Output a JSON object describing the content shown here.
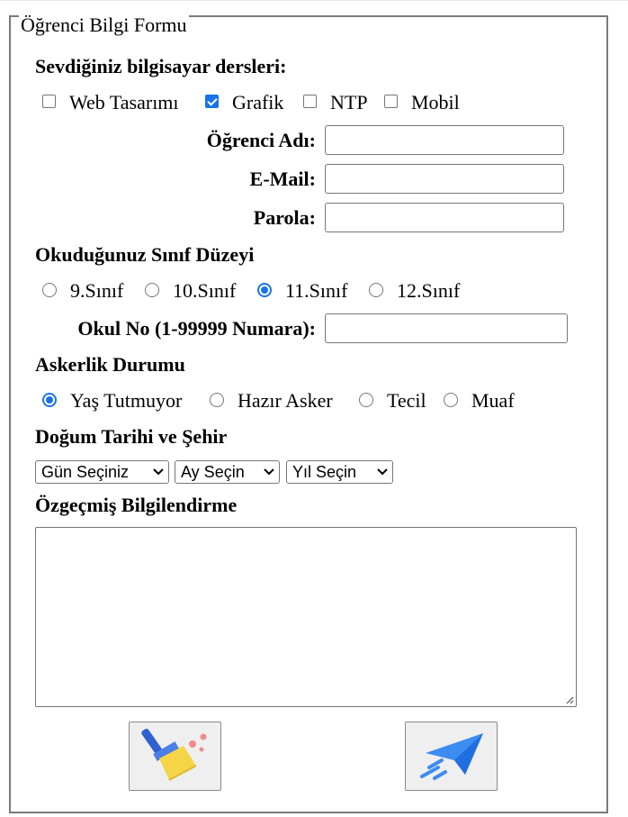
{
  "form": {
    "legend": "Öğrenci Bilgi Formu",
    "courses": {
      "heading": "Sevdiğiniz bilgisayar dersleri:",
      "options": [
        {
          "label": "Web Tasarımı",
          "checked": false
        },
        {
          "label": "Grafik",
          "checked": true
        },
        {
          "label": "NTP",
          "checked": false
        },
        {
          "label": "Mobil",
          "checked": false
        }
      ]
    },
    "fields": {
      "name_label": "Öğrenci Adı:",
      "name_value": "",
      "email_label": "E-Mail:",
      "email_value": "",
      "password_label": "Parola:",
      "password_value": ""
    },
    "grade": {
      "heading": "Okuduğunuz Sınıf Düzeyi",
      "options": [
        {
          "label": "9.Sınıf",
          "selected": false
        },
        {
          "label": "10.Sınıf",
          "selected": false
        },
        {
          "label": "11.Sınıf",
          "selected": true
        },
        {
          "label": "12.Sınıf",
          "selected": false
        }
      ]
    },
    "school_no": {
      "label": "Okul No (1-99999 Numara):",
      "value": ""
    },
    "military": {
      "heading": "Askerlik Durumu",
      "options": [
        {
          "label": "Yaş Tutmuyor",
          "selected": true
        },
        {
          "label": "Hazır Asker",
          "selected": false
        },
        {
          "label": "Tecil",
          "selected": false
        },
        {
          "label": "Muaf",
          "selected": false
        }
      ]
    },
    "birth": {
      "heading": "Doğum Tarihi ve Şehir",
      "day_select": "Gün Seçiniz",
      "month_select": "Ay Seçin",
      "year_select": "Yıl Seçin"
    },
    "bio": {
      "heading": "Özgeçmiş Bilgilendirme",
      "value": ""
    },
    "buttons": {
      "reset_icon": "broom-icon",
      "submit_icon": "paper-plane-icon"
    }
  },
  "colors": {
    "accent": "#1a73e8",
    "border": "#767676",
    "button_bg": "#efefef"
  }
}
